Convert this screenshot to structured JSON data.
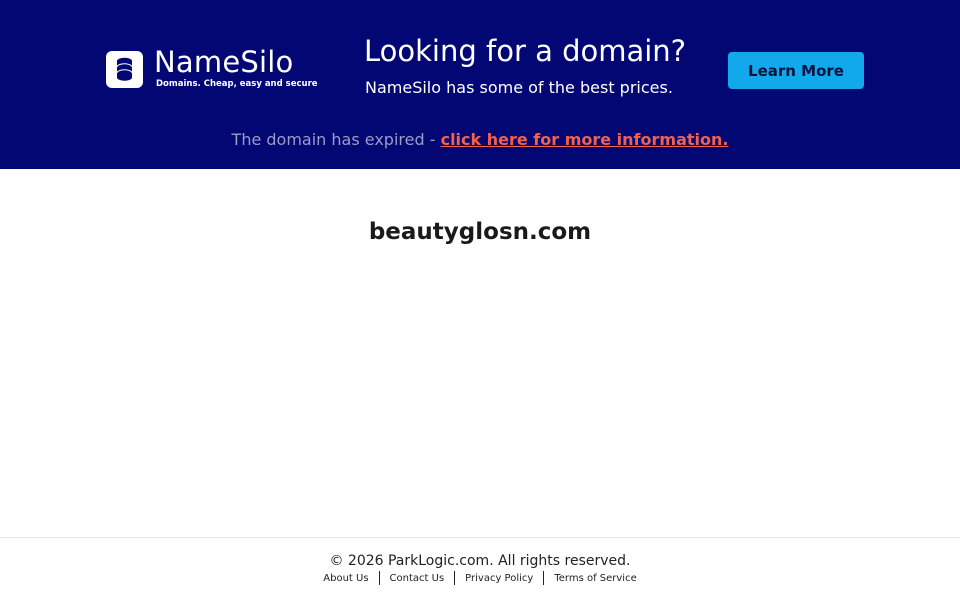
{
  "brand": {
    "name": "NameSilo",
    "tagline": "Domains. Cheap, easy and secure",
    "icon": "database-icon"
  },
  "promo": {
    "title": "Looking for a domain?",
    "subtitle": "NameSilo has some of the best prices.",
    "button_label": "Learn More"
  },
  "notice": {
    "text": "The domain has expired - ",
    "link_text": "click here for more information."
  },
  "domain": "beautyglosn.com",
  "footer": {
    "copyright": "© 2026 ParkLogic.com. All rights reserved.",
    "links": [
      "About Us",
      "Contact Us",
      "Privacy Policy",
      "Terms of Service"
    ]
  },
  "colors": {
    "banner_bg": "#020774",
    "button_bg": "#12a8ec",
    "link_accent": "#f2614b"
  }
}
